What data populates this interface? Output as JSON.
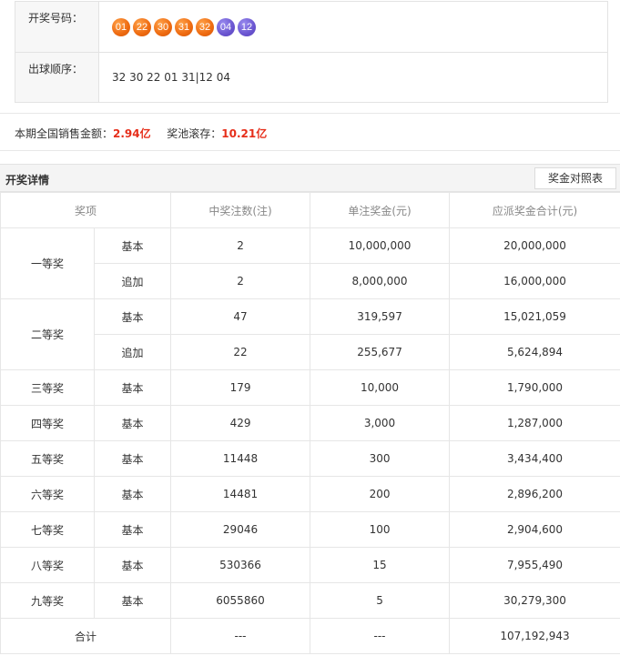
{
  "draw": {
    "number_label": "开奖号码：",
    "order_label": "出球顺序：",
    "front_balls": [
      "01",
      "22",
      "30",
      "31",
      "32"
    ],
    "back_balls": [
      "04",
      "12"
    ],
    "order_text": "32 30 22 01 31|12 04"
  },
  "sales": {
    "sales_label": "本期全国销售金额：",
    "sales_amount": "2.94亿",
    "pool_label": "奖池滚存：",
    "pool_amount": "10.21亿"
  },
  "detail": {
    "title": "开奖详情",
    "ref_button": "奖金对照表",
    "headers": [
      "奖项",
      "中奖注数(注)",
      "单注奖金(元)",
      "应派奖金合计(元)"
    ],
    "rows": [
      {
        "level": "一等奖",
        "type": "基本",
        "count": "2",
        "prize": "10,000,000",
        "total": "20,000,000"
      },
      {
        "level": "",
        "type": "追加",
        "count": "2",
        "prize": "8,000,000",
        "total": "16,000,000"
      },
      {
        "level": "二等奖",
        "type": "基本",
        "count": "47",
        "prize": "319,597",
        "total": "15,021,059"
      },
      {
        "level": "",
        "type": "追加",
        "count": "22",
        "prize": "255,677",
        "total": "5,624,894"
      },
      {
        "level": "三等奖",
        "type": "基本",
        "count": "179",
        "prize": "10,000",
        "total": "1,790,000"
      },
      {
        "level": "四等奖",
        "type": "基本",
        "count": "429",
        "prize": "3,000",
        "total": "1,287,000"
      },
      {
        "level": "五等奖",
        "type": "基本",
        "count": "11448",
        "prize": "300",
        "total": "3,434,400"
      },
      {
        "level": "六等奖",
        "type": "基本",
        "count": "14481",
        "prize": "200",
        "total": "2,896,200"
      },
      {
        "level": "七等奖",
        "type": "基本",
        "count": "29046",
        "prize": "100",
        "total": "2,904,600"
      },
      {
        "level": "八等奖",
        "type": "基本",
        "count": "530366",
        "prize": "15",
        "total": "7,955,490"
      },
      {
        "level": "九等奖",
        "type": "基本",
        "count": "6055860",
        "prize": "5",
        "total": "30,279,300"
      }
    ],
    "total_row": {
      "label": "合计",
      "count": "---",
      "prize": "---",
      "total": "107,192,943"
    }
  },
  "colors": {
    "front_ball": "#ee6a10",
    "back_ball": "#6a55d0",
    "highlight": "#e62e1a"
  }
}
